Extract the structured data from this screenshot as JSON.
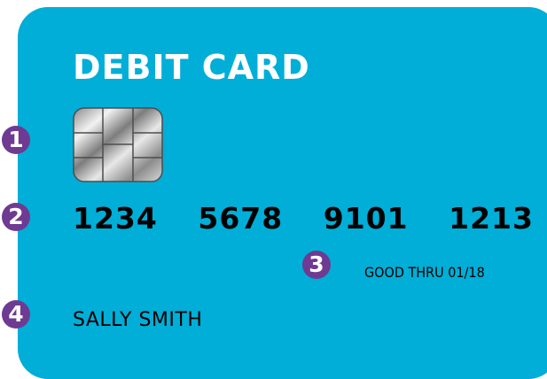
{
  "card": {
    "title": "DEBIT CARD",
    "number_groups": [
      "1234",
      "5678",
      "9101",
      "1213"
    ],
    "good_thru": "GOOD THRU 01/18",
    "holder_name": "SALLY SMITH"
  },
  "badges": {
    "chip": "1",
    "number": "2",
    "expiry": "3",
    "name": "4"
  },
  "colors": {
    "card_background": "#00aed7",
    "badge": "#6f3a92",
    "title_text": "#ffffff",
    "body_text": "#000000"
  },
  "icons": {
    "chip": "emv-chip-icon"
  }
}
